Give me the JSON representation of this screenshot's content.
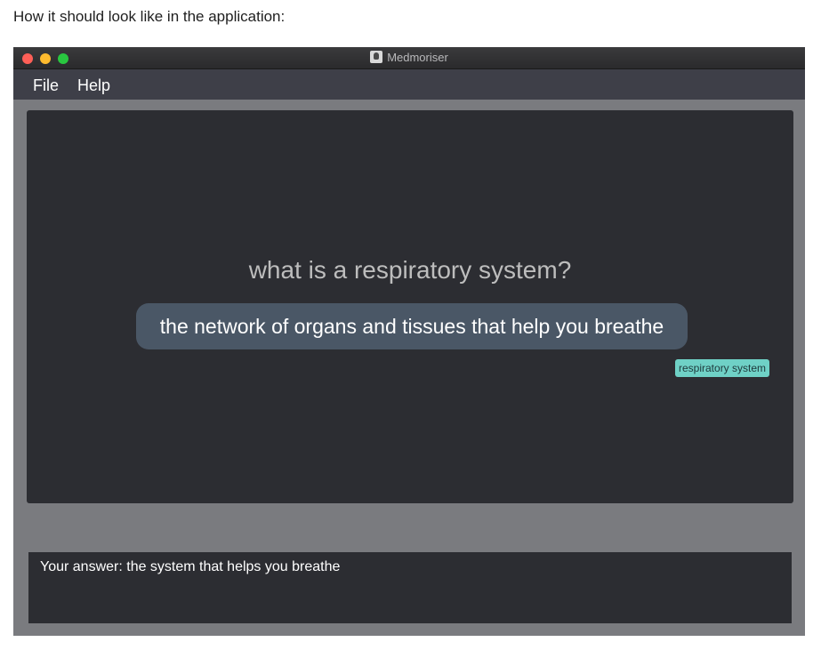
{
  "caption": "How it should look like in the application:",
  "window": {
    "title": "Medmoriser",
    "app_icon": "medmoriser-app-icon"
  },
  "menu": {
    "file": "File",
    "help": "Help"
  },
  "card": {
    "question": "what is a respiratory system?",
    "answer": "the network of organs and tissues that help you breathe",
    "tag": "respiratory system"
  },
  "command_box": {
    "text": "Your answer:  the system that helps you breathe"
  },
  "colors": {
    "card_background": "#2c2d32",
    "answer_background": "#4a5766",
    "tag_background": "#6fd1c6",
    "menubar_background": "#3e3f48"
  }
}
